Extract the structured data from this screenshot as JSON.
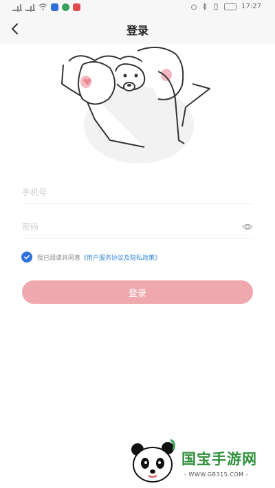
{
  "status_bar": {
    "time": "17:27",
    "colors": {
      "app1": "#2f6fdb",
      "app2": "#3aa05a",
      "app3": "#e24b4b"
    }
  },
  "header": {
    "back_icon": "chevron-left-icon",
    "title": "登录"
  },
  "illustration": {
    "icon": "mouse-mascot-illustration"
  },
  "form": {
    "phone_placeholder": "手机号",
    "phone_value": "",
    "password_placeholder": "密码",
    "password_value": "",
    "eye_icon": "eye-icon"
  },
  "agreement": {
    "checked": true,
    "text": "我已阅读并同意",
    "link": "《用户服务协议及隐私政策》"
  },
  "login_button": {
    "label": "登录",
    "color": "#efa8ad"
  },
  "watermark": {
    "name": "国宝手游网",
    "url": "- WWW.GB315.COM -"
  },
  "colors": {
    "accent_blue": "#2f6fdb",
    "link_blue": "#3d8bd9",
    "button_pink": "#efa8ad"
  }
}
